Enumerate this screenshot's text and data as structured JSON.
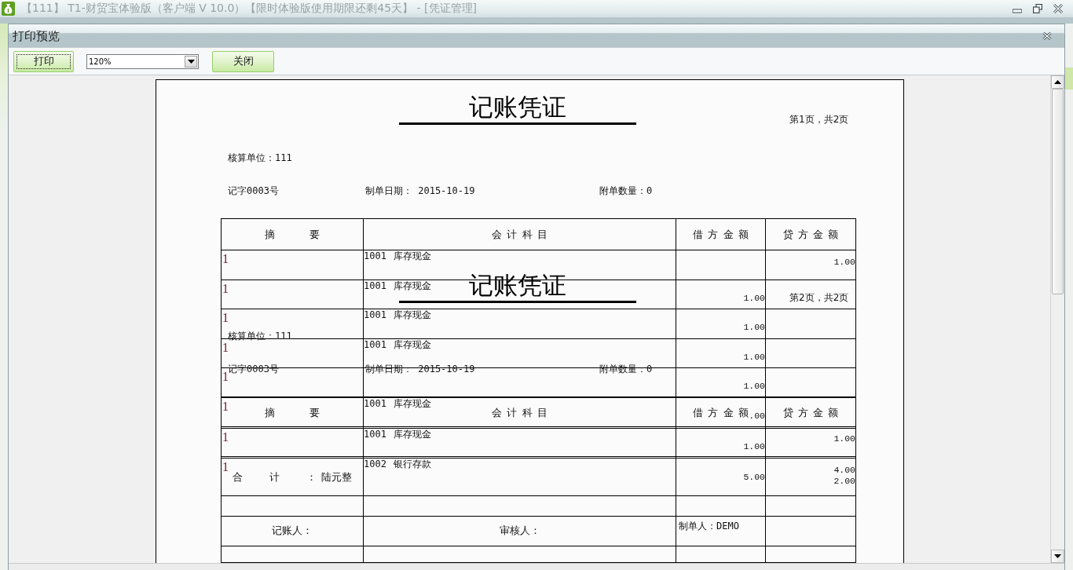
{
  "app_window": {
    "title": "【111】 T1-财贸宝体验版（客户端 V 10.0）【限时体验版使用期限还剩45天】 - [凭证管理]"
  },
  "dialog": {
    "title": "打印预览"
  },
  "toolbar": {
    "print_button": "打印",
    "zoom": {
      "value": "120%"
    },
    "close_button": "关闭"
  },
  "preview": {
    "pages": [
      {
        "title": "记账凭证",
        "page_number": "第1页，共2页",
        "accounting_unit": "核算单位：111",
        "voucher_number": "记字0003号",
        "date": "制单日期： 2015-10-19",
        "attachments": "附单数量：0",
        "columns": [
          "摘 要",
          "会 计 科 目",
          "借 方 金 额",
          "贷 方 金 额"
        ],
        "rows": [
          {
            "summary": "1",
            "account": "1001 库存现金",
            "credit": "1.00"
          },
          {
            "summary": "1",
            "account": "1001 库存现金",
            "debit": "1.00"
          },
          {
            "summary": "1",
            "account": "1001 库存现金",
            "debit": "1.00"
          },
          {
            "summary": "1",
            "account": "1001 库存现金",
            "debit": "1.00"
          },
          {
            "summary": "1",
            "debit": "1.00"
          },
          {
            "summary": "1",
            "account": "1001 库存现金",
            "debit": ".00"
          },
          {
            "credit": "1.00"
          }
        ],
        "total": {
          "label": "合 计 ：",
          "amount_in_words": "陆元整",
          "debit": "5.00",
          "credit": "2.00"
        },
        "signatures": [
          "记账人：",
          "审核人：",
          "制单人：DEMO"
        ]
      },
      {
        "title": "记账凭证",
        "page_number": "第2页，共2页",
        "accounting_unit": "核算单位：111",
        "voucher_number": "记字0003号",
        "date": "制单日期： 2015-10-19",
        "attachments": "附单数量：0",
        "columns": [
          "摘 要",
          "会 计 科 目",
          "借 方 金 额",
          "贷 方 金 额"
        ],
        "rows": [
          {
            "summary": "1",
            "account": "1001 库存现金",
            "debit": "1.00"
          },
          {
            "summary": "1",
            "account": "1002 银行存款",
            "credit": "4.00"
          }
        ]
      }
    ]
  }
}
